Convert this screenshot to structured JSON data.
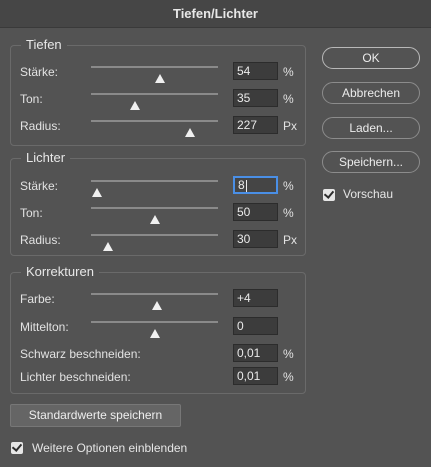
{
  "title": "Tiefen/Lichter",
  "groups": {
    "tiefen": {
      "title": "Tiefen",
      "rows": [
        {
          "label": "Stärke:",
          "value": "54",
          "unit": "%",
          "level": 0.54
        },
        {
          "label": "Ton:",
          "value": "35",
          "unit": "%",
          "level": 0.35
        },
        {
          "label": "Radius:",
          "value": "227",
          "unit": "Px",
          "level": 0.78
        }
      ]
    },
    "lichter": {
      "title": "Lichter",
      "rows": [
        {
          "label": "Stärke:",
          "value": "8",
          "unit": "%",
          "level": 0.05
        },
        {
          "label": "Ton:",
          "value": "50",
          "unit": "%",
          "level": 0.5
        },
        {
          "label": "Radius:",
          "value": "30",
          "unit": "Px",
          "level": 0.13
        }
      ]
    },
    "korrekturen": {
      "title": "Korrekturen",
      "rows": [
        {
          "label": "Farbe:",
          "value": "+4",
          "unit": "",
          "level": 0.52
        },
        {
          "label": "Mittelton:",
          "value": "0",
          "unit": "",
          "level": 0.5
        },
        {
          "label": "Schwarz beschneiden:",
          "value": "0,01",
          "unit": "%"
        },
        {
          "label": "Lichter beschneiden:",
          "value": "0,01",
          "unit": "%"
        }
      ]
    }
  },
  "buttons": {
    "ok": "OK",
    "cancel": "Abbrechen",
    "load": "Laden...",
    "save": "Speichern..."
  },
  "preview": {
    "label": "Vorschau",
    "checked": true
  },
  "defaults_button": "Standardwerte speichern",
  "more_options": {
    "label": "Weitere Optionen einblenden",
    "checked": true
  }
}
